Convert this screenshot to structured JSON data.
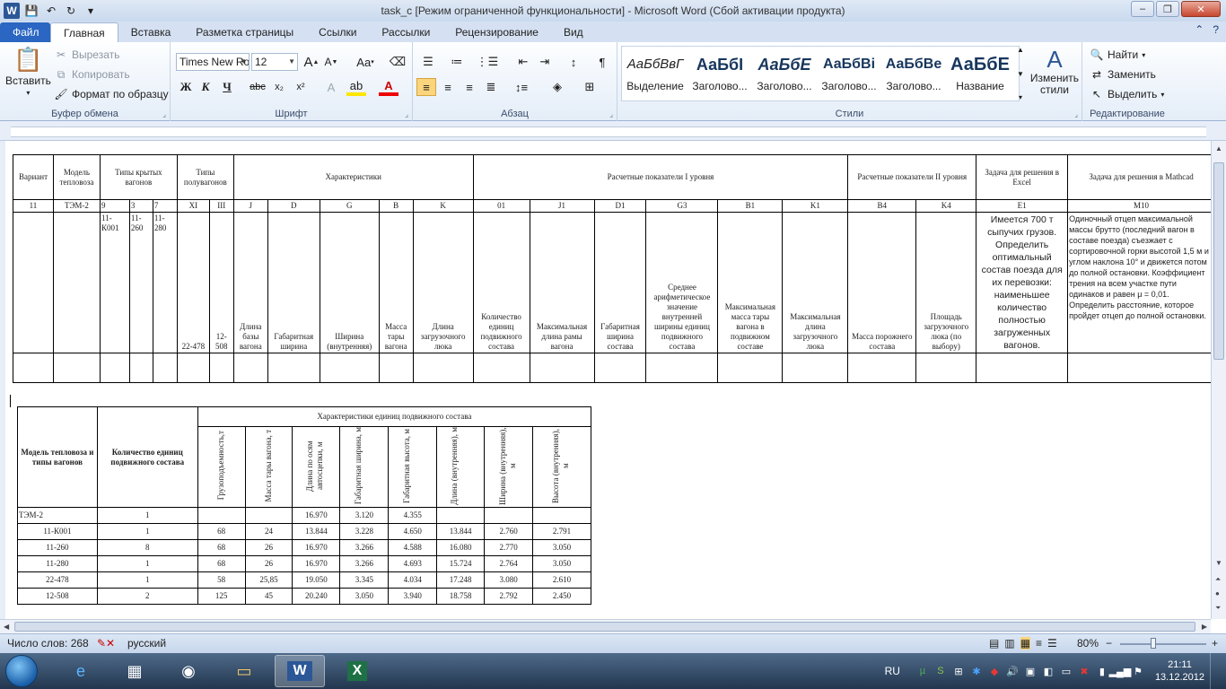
{
  "window": {
    "title": "task_c [Режим ограниченной функциональности]  -  Microsoft Word (Сбой активации продукта)",
    "app_letter": "W",
    "minimize": "–",
    "restore": "❐",
    "close": "✕"
  },
  "tabs": [
    {
      "label": "Файл"
    },
    {
      "label": "Главная"
    },
    {
      "label": "Вставка"
    },
    {
      "label": "Разметка страницы"
    },
    {
      "label": "Ссылки"
    },
    {
      "label": "Рассылки"
    },
    {
      "label": "Рецензирование"
    },
    {
      "label": "Вид"
    }
  ],
  "ribbon": {
    "clipboard": {
      "label": "Буфер обмена",
      "paste": "Вставить",
      "cut": "Вырезать",
      "copy": "Копировать",
      "format_painter": "Формат по образцу"
    },
    "font": {
      "label": "Шрифт",
      "font_name": "Times New Ro",
      "font_size": "12",
      "grow": "A",
      "shrink": "A",
      "case": "Aa",
      "bold": "Ж",
      "italic": "К",
      "underline": "Ч",
      "strike": "abc",
      "subscript": "x₂",
      "superscript": "x²"
    },
    "paragraph": {
      "label": "Абзац"
    },
    "styles": {
      "label": "Стили",
      "items": [
        {
          "preview": "АаБбВвГ",
          "name": "Выделение"
        },
        {
          "preview": "АаБбІ",
          "name": "Заголово..."
        },
        {
          "preview": "АаБбЕ",
          "name": "Заголово..."
        },
        {
          "preview": "АаБбВі",
          "name": "Заголово..."
        },
        {
          "preview": "АаБбВе",
          "name": "Заголово..."
        },
        {
          "preview": "АаБбЕ",
          "name": "Название"
        }
      ],
      "change_styles": "Изменить стили"
    },
    "editing": {
      "label": "Редактирование",
      "find": "Найти",
      "replace": "Заменить",
      "select": "Выделить"
    }
  },
  "table1": {
    "header": {
      "variant": "Вариант",
      "model": "Модель тепловоза",
      "covered": "Типы крытых вагонов",
      "gondola": "Типы полувагонов",
      "chars": "Характеристики",
      "level1": "Расчетные показатели I уровня",
      "level2": "Расчетные показатели II уровня",
      "excel_task": "Задача для решения в Excel",
      "mathcad_task": "Задача для решения в Mathcad"
    },
    "codes": [
      "11",
      "ТЭМ-2",
      "9",
      "3",
      "7",
      "XI",
      "III",
      "J",
      "D",
      "G",
      "B",
      "K",
      "01",
      "J1",
      "D1",
      "G3",
      "B1",
      "K1",
      "B4",
      "K4",
      "E1",
      "M10"
    ],
    "row3": {
      "c9": "11-К001",
      "c3": "11-260",
      "c7": "11-280",
      "xi": "22-478",
      "iii": "12-508",
      "j": "Длина базы вагона",
      "d": "Габаритная ширина",
      "g": "Ширина (внутренняя)",
      "b": "Масса тары вагона",
      "k": "Длина загрузочного люка",
      "o1": "Количество единиц подвижного состава",
      "j1": "Максимальная длина рамы вагона",
      "d1": "Габаритная ширина состава",
      "g3": "Среднее арифметическое значение внутренней ширины единиц подвижного состава",
      "b1": "Максимальная масса тары вагона в подвижном составе",
      "k1": "Максимальная длина загрузочного люка",
      "b4": "Масса порожнего состава",
      "k4": "Площадь загрузочного люка (по выбору)",
      "e1": "Имеется 700 т сыпучих грузов. Определить оптимальный состав поезда для их перевозки: наименьшее количество полностью загруженных вагонов.",
      "m10": "Одиночный отцеп максимальной массы брутто (последний вагон в составе поезда) съезжает с сортировочной горки высотой 1,5 м и углом наклона 10° и движется потом до полной остановки. Коэффициент трения на всем участке пути одинаков и равен  μ = 0,01. Определить расстояние, которое пройдет отцеп до полной остановки."
    }
  },
  "table2": {
    "h_model": "Модель тепловоза и типы вагонов",
    "h_count": "Количество единиц подвижного состава",
    "h_chars": "Характеристики единиц подвижного состава",
    "cols": [
      "Грузоподъемность,т",
      "Масса тары вагона, т",
      "Длина по осям автосцепки, м",
      "Габаритная ширина, м",
      "Габаритная высота, м",
      "Длина (внутренняя), м",
      "Ширина (внутренняя), м",
      "Высота (внутренняя), м"
    ],
    "rows": [
      {
        "name": "ТЭМ-2",
        "count": "1",
        "v": [
          "",
          "",
          "16.970",
          "3.120",
          "4.355",
          "",
          "",
          ""
        ]
      },
      {
        "name": "11-К001",
        "count": "1",
        "v": [
          "68",
          "24",
          "13.844",
          "3.228",
          "4.650",
          "13.844",
          "2.760",
          "2.791"
        ]
      },
      {
        "name": "11-260",
        "count": "8",
        "v": [
          "68",
          "26",
          "16.970",
          "3.266",
          "4.588",
          "16.080",
          "2.770",
          "3.050"
        ]
      },
      {
        "name": "11-280",
        "count": "1",
        "v": [
          "68",
          "26",
          "16.970",
          "3.266",
          "4.693",
          "15.724",
          "2.764",
          "3.050"
        ]
      },
      {
        "name": "22-478",
        "count": "1",
        "v": [
          "58",
          "25,85",
          "19.050",
          "3.345",
          "4.034",
          "17.248",
          "3.080",
          "2.610"
        ]
      },
      {
        "name": "12-508",
        "count": "2",
        "v": [
          "125",
          "45",
          "20.240",
          "3.050",
          "3.940",
          "18.758",
          "2.792",
          "2.450"
        ]
      }
    ]
  },
  "status": {
    "words": "Число слов: 268",
    "lang": "русский",
    "zoom": "80%",
    "zoom_minus": "−",
    "zoom_plus": "+"
  },
  "taskbar": {
    "lang": "RU",
    "time": "21:11",
    "date": "13.12.2012"
  },
  "colors": {
    "accent": "#2a66c2",
    "ribbon_bg": "#e4edf8",
    "taskbar": "#22364e"
  }
}
